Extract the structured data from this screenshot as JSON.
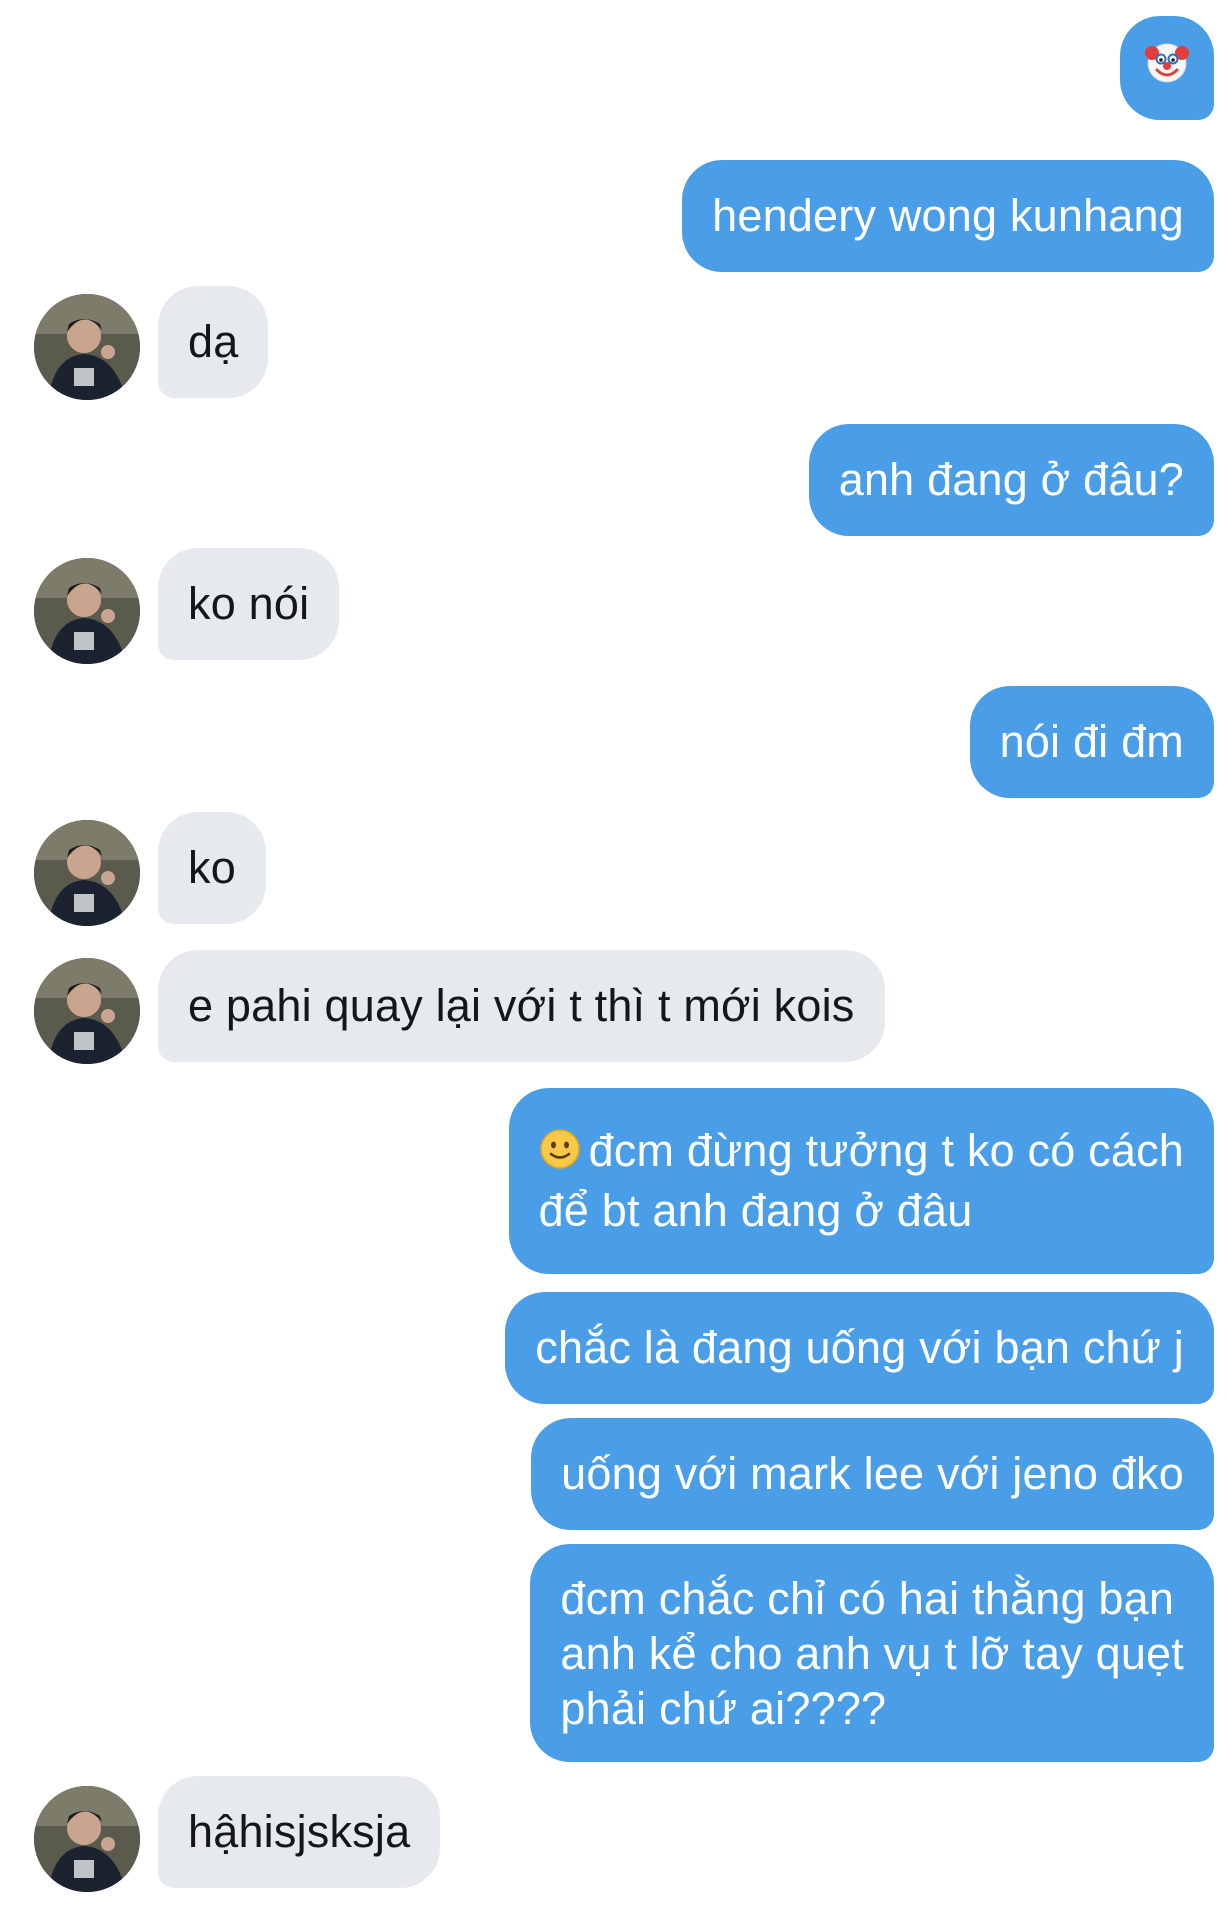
{
  "thread": {
    "messages": [
      {
        "side": "out",
        "text": "",
        "emoji": "clown-face-icon"
      },
      {
        "side": "out",
        "text": "hendery wong kunhang"
      },
      {
        "side": "in",
        "text": "dạ"
      },
      {
        "side": "out",
        "text": "anh đang ở đâu?"
      },
      {
        "side": "in",
        "text": "ko nói"
      },
      {
        "side": "out",
        "text": "nói đi đm"
      },
      {
        "side": "in",
        "text": "ko"
      },
      {
        "side": "in",
        "text": "e pahi quay lại với t thì t mới kois"
      },
      {
        "side": "out",
        "text": "đcm đừng tưởng t ko có cách để bt anh đang ở đâu",
        "lines": [
          "đcm đừng tưởng t ko có cách",
          "để bt anh đang ở đâu"
        ],
        "emoji": "slightly-smiling-face-icon"
      },
      {
        "side": "out",
        "text": "chắc là đang uống với bạn chứ j"
      },
      {
        "side": "out",
        "text": "uống với mark lee với jeno đko"
      },
      {
        "side": "out",
        "text": "đcm chắc chỉ có hai thằng bạn anh kể cho anh vụ t lỡ tay quẹt phải chứ ai????",
        "lines": [
          "đcm chắc chỉ có hai thằng bạn",
          "anh kể cho anh vụ t lỡ tay quẹt",
          "phải chứ ai????"
        ]
      },
      {
        "side": "in",
        "text": "hậhisjsksja"
      }
    ]
  },
  "colors": {
    "outgoing_bubble": "#4a9ee8",
    "incoming_bubble": "#e6e9ee",
    "outgoing_text": "#ffffff",
    "incoming_text": "#14171a"
  }
}
